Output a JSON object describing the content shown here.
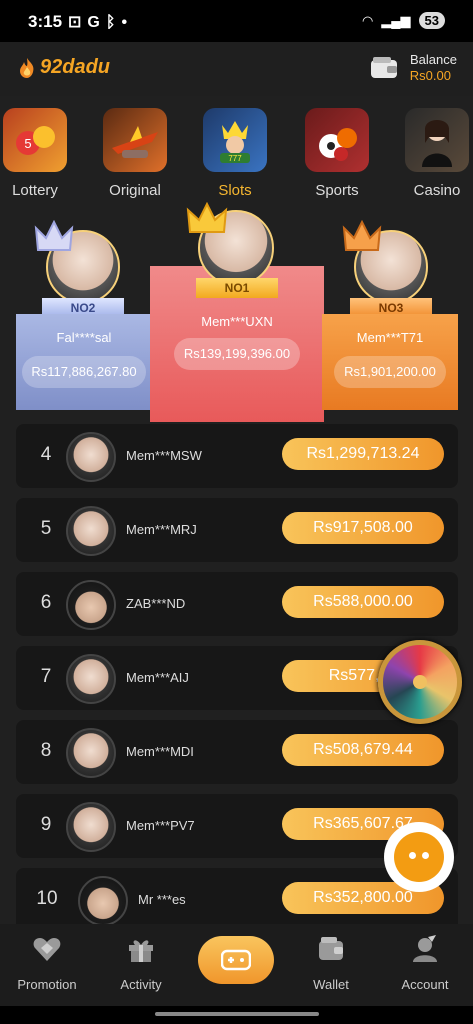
{
  "status": {
    "time": "3:15",
    "left_icons": "G",
    "battery": "53"
  },
  "header": {
    "logo_text": "92dadu",
    "balance_label": "Balance",
    "balance_value": "Rs0.00"
  },
  "categories": [
    {
      "label": "Lottery",
      "active": false
    },
    {
      "label": "Original",
      "active": false
    },
    {
      "label": "Slots",
      "active": true
    },
    {
      "label": "Sports",
      "active": false
    },
    {
      "label": "Casino",
      "active": false
    }
  ],
  "podium": {
    "first": {
      "rank": "NO1",
      "name": "Mem***UXN",
      "amount": "Rs139,199,396.00"
    },
    "second": {
      "rank": "NO2",
      "name": "Fal****sal",
      "amount": "Rs117,886,267.80"
    },
    "third": {
      "rank": "NO3",
      "name": "Mem***T71",
      "amount": "Rs1,901,200.00"
    }
  },
  "rankings": [
    {
      "rank": "4",
      "name": "Mem***MSW",
      "amount": "Rs1,299,713.24"
    },
    {
      "rank": "5",
      "name": "Mem***MRJ",
      "amount": "Rs917,508.00"
    },
    {
      "rank": "6",
      "name": "ZAB***ND",
      "amount": "Rs588,000.00"
    },
    {
      "rank": "7",
      "name": "Mem***AIJ",
      "amount": "Rs577,16"
    },
    {
      "rank": "8",
      "name": "Mem***MDI",
      "amount": "Rs508,679.44"
    },
    {
      "rank": "9",
      "name": "Mem***PV7",
      "amount": "Rs365,607.67"
    },
    {
      "rank": "10",
      "name": "Mr ***es",
      "amount": "Rs352,800.00"
    }
  ],
  "nav": [
    {
      "label": "Promotion",
      "icon": "diamond-heart-icon"
    },
    {
      "label": "Activity",
      "icon": "gift-icon"
    },
    {
      "label": "",
      "icon": "gamepad-icon"
    },
    {
      "label": "Wallet",
      "icon": "wallet-icon"
    },
    {
      "label": "Account",
      "icon": "user-icon"
    }
  ],
  "colors": {
    "accent": "#f5a524",
    "first_place": "#f26b6b",
    "second_place": "#b8c4e8",
    "third_place": "#f59a3d"
  }
}
